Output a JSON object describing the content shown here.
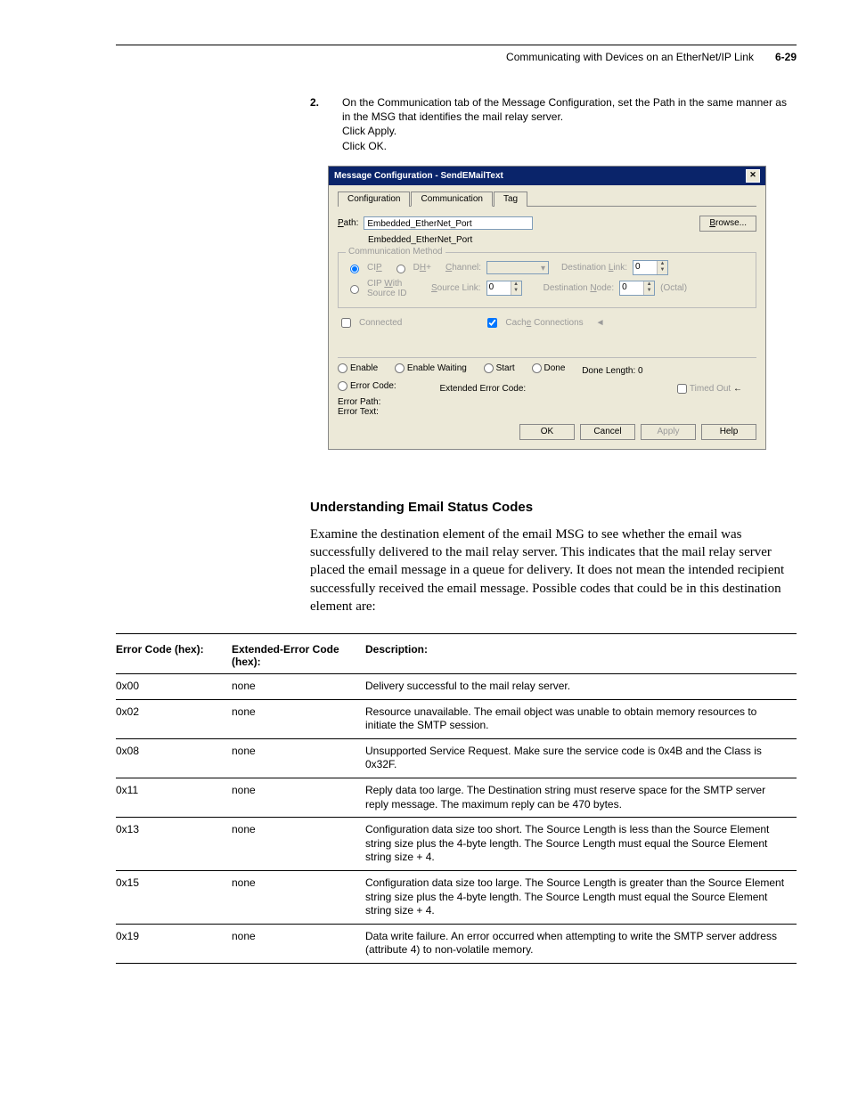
{
  "header": {
    "title": "Communicating with Devices on an EtherNet/IP Link",
    "page": "6-29"
  },
  "step": {
    "number": "2.",
    "line1": "On the Communication tab of the Message Configuration, set the Path in the same manner as in the MSG that identifies the mail relay server.",
    "line2": "Click Apply.",
    "line3": "Click OK."
  },
  "dialog": {
    "title": "Message Configuration - SendEMailText",
    "tabs": {
      "configuration": "Configuration",
      "communication": "Communication",
      "tag": "Tag"
    },
    "path_label": "Path:",
    "path_value": "Embedded_EtherNet_Port",
    "path_echo": "Embedded_EtherNet_Port",
    "browse": "Browse...",
    "comm_method_title": "Communication Method",
    "cip": "CIP",
    "dhplus": "DH+",
    "channel": "Channel:",
    "dest_link": "Destination Link:",
    "cip_with_source": "CIP With Source ID",
    "source_link": "Source Link:",
    "dest_node": "Destination Node:",
    "octal": "(Octal)",
    "connected": "Connected",
    "cache": "Cache Connections",
    "spin_val": "0",
    "status": {
      "enable": "Enable",
      "enable_waiting": "Enable Waiting",
      "start": "Start",
      "done": "Done",
      "done_length_label": "Done Length:",
      "done_length_val": "0",
      "error_code": "Error Code:",
      "ext_error_code": "Extended Error Code:",
      "timed_out": "Timed Out",
      "error_path": "Error Path:",
      "error_text": "Error Text:"
    },
    "buttons": {
      "ok": "OK",
      "cancel": "Cancel",
      "apply": "Apply",
      "help": "Help"
    }
  },
  "section_heading": "Understanding Email Status Codes",
  "body_para": "Examine the destination element of the email MSG to see whether the email was successfully delivered to the mail relay server. This indicates that the mail relay server placed the email message in a queue for delivery. It does not mean the intended recipient successfully received the email message. Possible codes that could be in this destination element are:",
  "table": {
    "headers": {
      "c1": "Error Code (hex):",
      "c2": "Extended-Error Code (hex):",
      "c3": "Description:"
    },
    "rows": [
      {
        "code": "0x00",
        "ext": "none",
        "desc": "Delivery successful to the mail relay server."
      },
      {
        "code": "0x02",
        "ext": "none",
        "desc": "Resource unavailable. The email object was unable to obtain memory resources to initiate the SMTP session."
      },
      {
        "code": "0x08",
        "ext": "none",
        "desc": "Unsupported Service Request. Make sure the service code is 0x4B and the Class is 0x32F."
      },
      {
        "code": "0x11",
        "ext": "none",
        "desc": "Reply data too large. The Destination string must reserve space for the SMTP server reply message. The maximum reply can be 470 bytes."
      },
      {
        "code": "0x13",
        "ext": "none",
        "desc": "Configuration data size too short. The Source Length is less than the Source Element string size plus the 4-byte length. The Source Length must equal the Source Element string size + 4."
      },
      {
        "code": "0x15",
        "ext": "none",
        "desc": "Configuration data size too large. The Source Length is greater than the Source Element string size plus the 4-byte length. The Source Length must equal the Source Element string size + 4."
      },
      {
        "code": "0x19",
        "ext": "none",
        "desc": "Data write failure. An error occurred when attempting to write the SMTP server address (attribute 4) to non-volatile memory."
      }
    ]
  }
}
